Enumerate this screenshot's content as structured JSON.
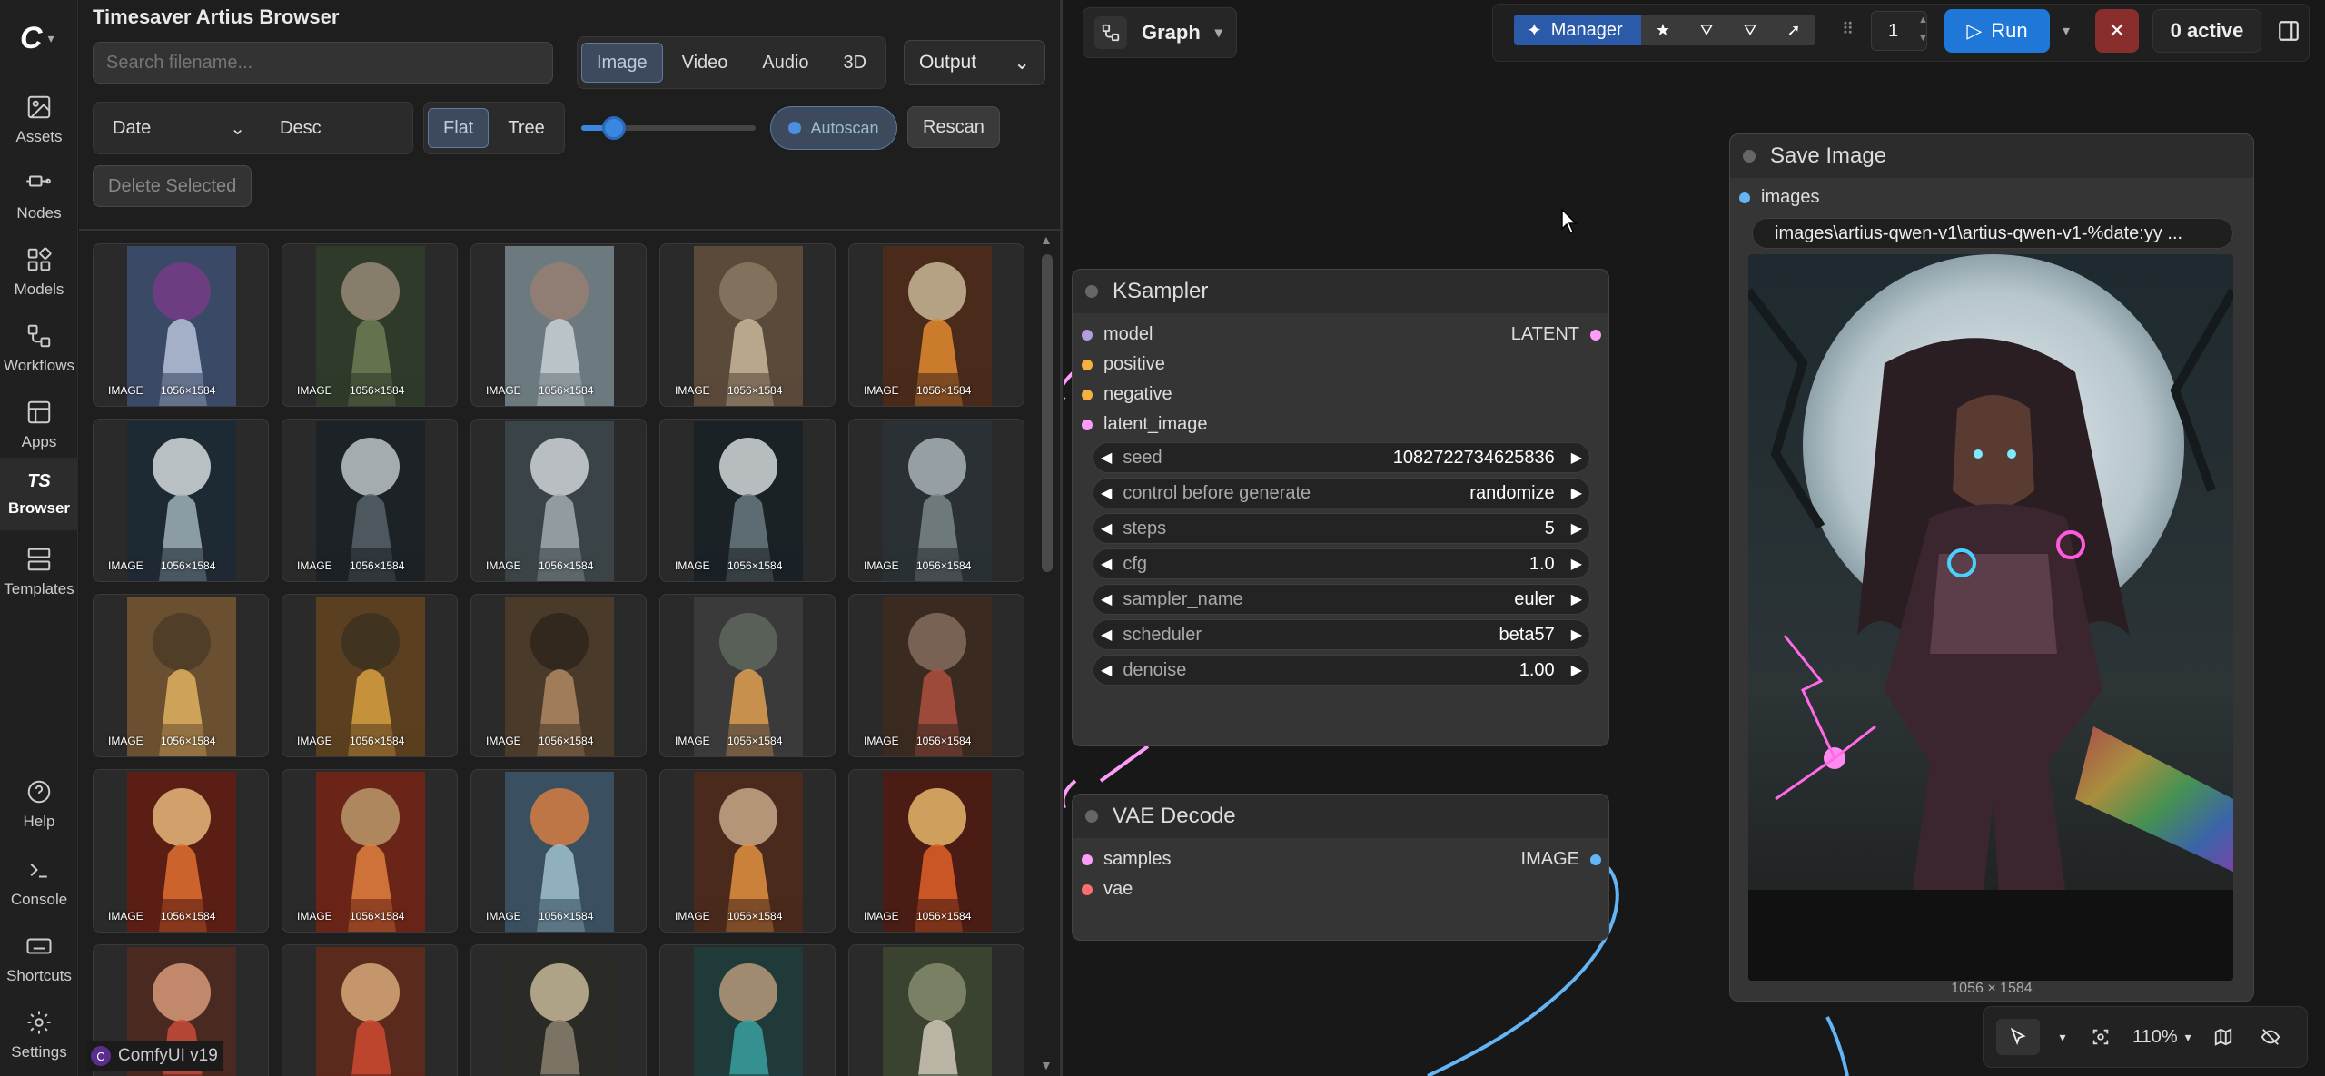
{
  "sidebar": {
    "items": [
      {
        "label": "Assets",
        "icon": "image-icon"
      },
      {
        "label": "Nodes",
        "icon": "nodes-icon"
      },
      {
        "label": "Models",
        "icon": "models-icon"
      },
      {
        "label": "Workflows",
        "icon": "workflow-icon"
      },
      {
        "label": "Apps",
        "icon": "apps-icon"
      },
      {
        "label": "Browser",
        "icon": "ts-icon",
        "glyph": "TS"
      },
      {
        "label": "Templates",
        "icon": "templates-icon"
      },
      {
        "label": "Help",
        "icon": "help-icon"
      },
      {
        "label": "Console",
        "icon": "console-icon"
      },
      {
        "label": "Shortcuts",
        "icon": "keyboard-icon"
      },
      {
        "label": "Settings",
        "icon": "gear-icon"
      }
    ],
    "version": "ComfyUI v19"
  },
  "browser": {
    "title": "Timesaver Artius Browser",
    "search_placeholder": "Search filename...",
    "media_tabs": [
      "Image",
      "Video",
      "Audio",
      "3D"
    ],
    "output_select": "Output",
    "sort_select": "Date",
    "order_button": "Desc",
    "view_tabs": [
      "Flat",
      "Tree"
    ],
    "thumb_size_fraction": 0.12,
    "autoscan_label": "Autoscan",
    "rescan_label": "Rescan",
    "delete_label": "Delete Selected",
    "thumb_type": "IMAGE",
    "thumb_dims": "1056×1584"
  },
  "canvas": {
    "graph_label": "Graph",
    "manager_label": "Manager",
    "queue_count": "1",
    "run_label": "Run",
    "active_label": "0 active",
    "zoom_label": "110%"
  },
  "ksampler": {
    "title": "KSampler",
    "inputs": [
      "model",
      "positive",
      "negative",
      "latent_image"
    ],
    "output": "LATENT",
    "widgets": [
      {
        "name": "seed",
        "value": "1082722734625836"
      },
      {
        "name": "control before generate",
        "value": "randomize"
      },
      {
        "name": "steps",
        "value": "5"
      },
      {
        "name": "cfg",
        "value": "1.0"
      },
      {
        "name": "sampler_name",
        "value": "euler"
      },
      {
        "name": "scheduler",
        "value": "beta57"
      },
      {
        "name": "denoise",
        "value": "1.00"
      }
    ]
  },
  "vae_decode": {
    "title": "VAE Decode",
    "inputs": [
      "samples",
      "vae"
    ],
    "output": "IMAGE"
  },
  "save_image": {
    "title": "Save Image",
    "input": "images",
    "filename_prefix": "images\\artius-qwen-v1\\artius-qwen-v1-%date:yy ...",
    "preview_dims": "1056 × 1584"
  },
  "colors": {
    "accent": "#1f77d8",
    "model_slot": "#b39ddb",
    "conditioning_slot": "#f5b041",
    "latent_slot": "#ff9cf9",
    "image_slot": "#64b5f6",
    "vae_slot": "#ff6e6e"
  }
}
